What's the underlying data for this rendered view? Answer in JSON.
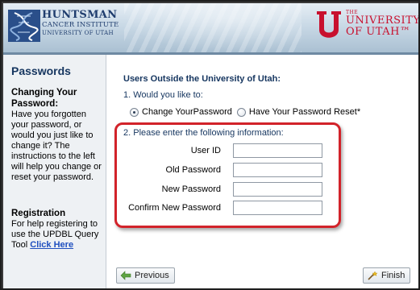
{
  "header": {
    "hci": {
      "name": "HUNTSMAN",
      "line1": "CANCER INSTITUTE",
      "line2": "UNIVERSITY OF UTAH",
      "icon": "hci-dna-logo-icon"
    },
    "uou": {
      "the": "THE",
      "univ": "UNIVERSITY",
      "utah": "OF UTAH™",
      "icon": "block-u-logo-icon"
    }
  },
  "sidebar": {
    "title": "Passwords",
    "section1": {
      "heading": "Changing Your Password:",
      "body": "Have you forgotten your password, or would you just like to change it? The instructions to the left will help you change or reset your password."
    },
    "section2": {
      "heading": "Registration",
      "body": "For help registering to use the UPDBL Query Tool",
      "link": "Click Here"
    }
  },
  "main": {
    "title": "Users Outside the University of Utah:",
    "step1": "1. Would you like to:",
    "options": [
      {
        "label": "Change YourPassword",
        "selected": true
      },
      {
        "label": "Have Your Password Reset*",
        "selected": false
      }
    ],
    "step2": "2. Please enter the following information:",
    "fields": [
      {
        "label": "User ID",
        "value": ""
      },
      {
        "label": "Old Password",
        "value": ""
      },
      {
        "label": "New Password",
        "value": ""
      },
      {
        "label": "Confirm New Password",
        "value": ""
      }
    ],
    "highlight_color": "#d2232a"
  },
  "footer": {
    "previous": "Previous",
    "finish": "Finish"
  }
}
